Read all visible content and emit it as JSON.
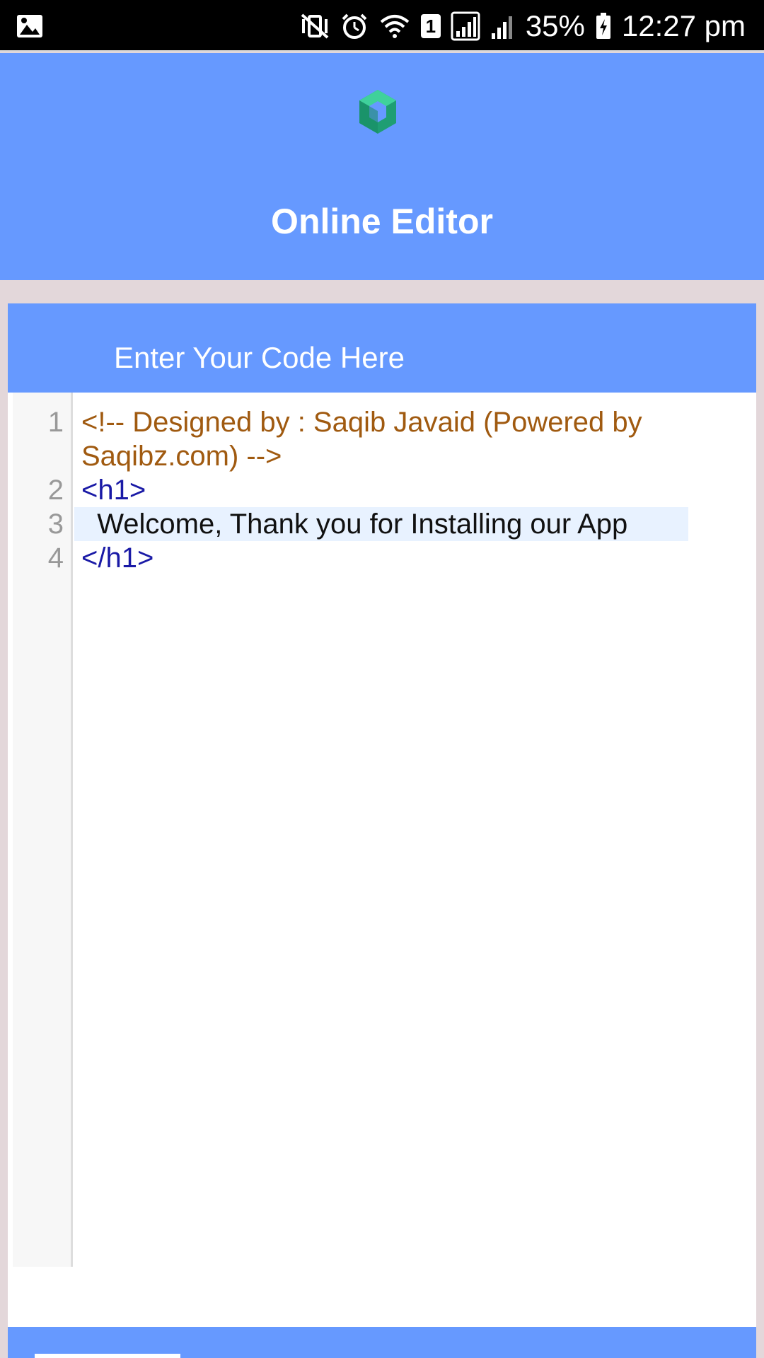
{
  "status_bar": {
    "battery_percent": "35%",
    "time": "12:27 pm",
    "sim_slot": "1",
    "icons": [
      "image-notification-icon",
      "mute-vibrate-icon",
      "alarm-icon",
      "wifi-icon",
      "sim-badge-icon",
      "signal-icon",
      "signal-secondary-icon",
      "battery-charging-icon"
    ]
  },
  "header": {
    "title": "Online Editor",
    "logo_icon": "cube-ring-logo-icon",
    "color": "#6699ff"
  },
  "editor": {
    "label": "Enter Your Code Here",
    "line_numbers": [
      "1",
      "2",
      "3",
      "4"
    ],
    "lines": [
      {
        "text": "<!-- Designed by : Saqib Javaid (Powered by",
        "kind": "comment"
      },
      {
        "text": "Saqibz.com) -->",
        "kind": "comment"
      },
      {
        "text": "<h1>",
        "kind": "tag"
      },
      {
        "text": "  Welcome, Thank you for Installing our App",
        "kind": "text"
      },
      {
        "text": "</h1>",
        "kind": "tag"
      }
    ],
    "colors": {
      "comment": "#a05a10",
      "tag": "#1a1aa6",
      "text": "#111111",
      "active_line": "#e8f2ff"
    }
  }
}
